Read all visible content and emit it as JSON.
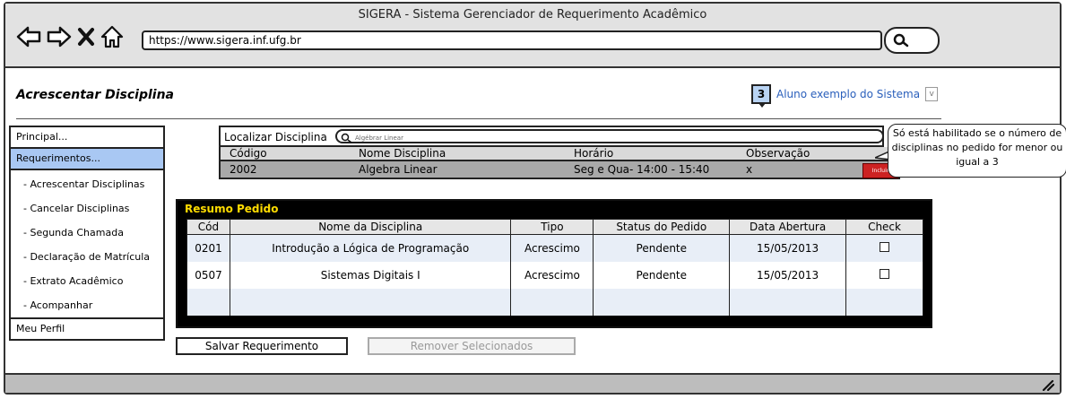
{
  "window": {
    "title": "SIGERA - Sistema Gerenciador de Requerimento Acadêmico"
  },
  "browser": {
    "url": "https://www.sigera.inf.ufg.br"
  },
  "page": {
    "title": "Acrescentar Disciplina"
  },
  "user": {
    "badge_count": "3",
    "name": "Aluno exemplo do Sistema"
  },
  "menu": {
    "principal": "Principal...",
    "requerimentos": "Requerimentos...",
    "subitems": [
      "- Acrescentar Disciplinas",
      "- Cancelar Disciplinas",
      "- Segunda Chamada",
      "- Declaração de Matrícula",
      "- Extrato Acadêmico",
      "- Acompanhar"
    ],
    "perfil": "Meu Perfil"
  },
  "search": {
    "label": "Localizar Disciplina",
    "placeholder": "Algébrar Linear",
    "headers": [
      "Código",
      "Nome Disciplina",
      "Horário",
      "Observação"
    ],
    "row": {
      "codigo": "2002",
      "nome": "Algebra Linear",
      "horario": "Seg e Qua- 14:00 - 15:40",
      "obs": "x",
      "action": "Incluir"
    }
  },
  "tooltip": {
    "text": "Só está habilitado se o número de disciplinas no pedido for menor ou igual a 3"
  },
  "resumo": {
    "title": "Resumo Pedido",
    "headers": [
      "Cód",
      "Nome da Disciplina",
      "Tipo",
      "Status do Pedido",
      "Data Abertura",
      "Check"
    ],
    "rows": [
      {
        "cod": "0201",
        "nome": "Introdução a Lógica de Programação",
        "tipo": "Acrescimo",
        "status": "Pendente",
        "data": "15/05/2013",
        "checked": false
      },
      {
        "cod": "0507",
        "nome": "Sistemas Digitais I",
        "tipo": "Acrescimo",
        "status": "Pendente",
        "data": "15/05/2013",
        "checked": false
      }
    ]
  },
  "buttons": {
    "save": "Salvar Requerimento",
    "remove": "Remover Selecionados"
  },
  "colors": {
    "accent": "#a9c8f3",
    "link": "#2a5fbb",
    "resumo_title": "#ffdc00",
    "incluir": "#cc2222"
  }
}
